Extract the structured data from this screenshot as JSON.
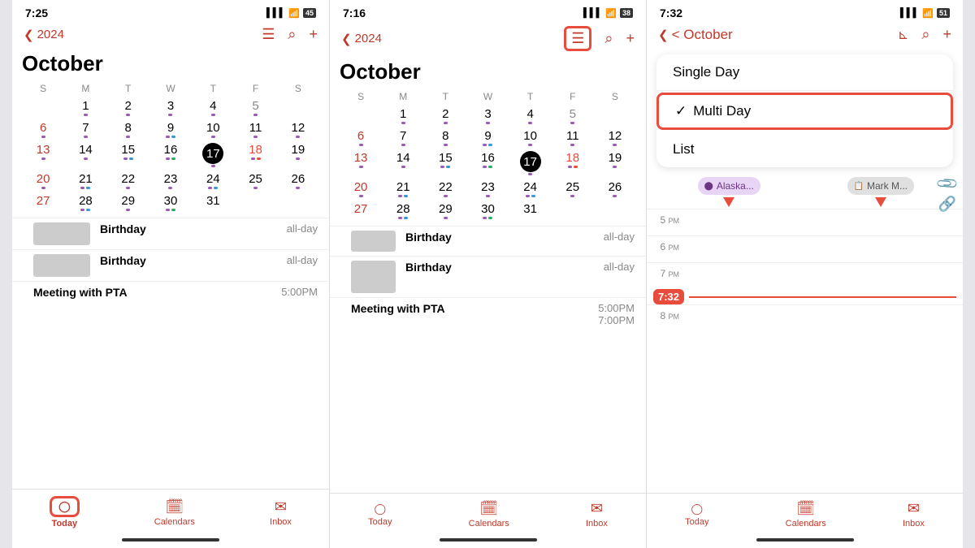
{
  "phone1": {
    "status_time": "7:25",
    "status_signal": "▌▌▌",
    "status_wifi": "WiFi",
    "status_battery": "45",
    "nav_back": "< 2024",
    "nav_year": "2024",
    "month_title": "October",
    "day_headers": [
      "S",
      "M",
      "T",
      "W",
      "T",
      "F",
      "S"
    ],
    "calendar_weeks": [
      [
        {
          "n": "",
          "dots": []
        },
        {
          "n": "1",
          "dots": [
            "purple"
          ]
        },
        {
          "n": "2",
          "dots": [
            "purple"
          ]
        },
        {
          "n": "3",
          "dots": [
            "purple"
          ]
        },
        {
          "n": "4",
          "dots": [
            "purple"
          ]
        },
        {
          "n": "5",
          "dots": [
            "purple"
          ],
          "cls": "saturday"
        },
        {
          "n": "",
          "dots": []
        }
      ],
      [
        {
          "n": "6",
          "cls": "sunday",
          "dots": [
            "purple"
          ]
        },
        {
          "n": "7",
          "dots": [
            "purple"
          ]
        },
        {
          "n": "8",
          "dots": [
            "purple"
          ]
        },
        {
          "n": "9",
          "dots": [
            "purple",
            "blue"
          ]
        },
        {
          "n": "10",
          "dots": [
            "purple"
          ]
        },
        {
          "n": "11",
          "dots": [
            "purple"
          ]
        },
        {
          "n": "12",
          "dots": [
            "purple"
          ]
        }
      ],
      [
        {
          "n": "13",
          "cls": "sunday",
          "dots": [
            "purple"
          ]
        },
        {
          "n": "14",
          "dots": [
            "purple"
          ]
        },
        {
          "n": "15",
          "dots": [
            "purple",
            "blue"
          ]
        },
        {
          "n": "16",
          "dots": [
            "purple",
            "green"
          ]
        },
        {
          "n": "17",
          "cls": "today",
          "dots": [
            "purple"
          ]
        },
        {
          "n": "18",
          "cls": "red-num",
          "dots": [
            "purple",
            "red"
          ]
        },
        {
          "n": "19",
          "dots": [
            "purple"
          ]
        }
      ],
      [
        {
          "n": "20",
          "cls": "sunday",
          "dots": [
            "purple"
          ]
        },
        {
          "n": "21",
          "dots": [
            "purple",
            "blue"
          ]
        },
        {
          "n": "22",
          "dots": [
            "purple"
          ]
        },
        {
          "n": "23",
          "dots": [
            "purple"
          ]
        },
        {
          "n": "24",
          "dots": [
            "purple",
            "blue"
          ]
        },
        {
          "n": "25",
          "dots": [
            "purple"
          ]
        },
        {
          "n": "26",
          "dots": [
            "purple"
          ]
        }
      ],
      [
        {
          "n": "27",
          "cls": "sunday",
          "dots": []
        },
        {
          "n": "28",
          "dots": [
            "purple",
            "blue"
          ]
        },
        {
          "n": "29",
          "dots": [
            "purple"
          ]
        },
        {
          "n": "30",
          "dots": [
            "purple",
            "green"
          ]
        },
        {
          "n": "31",
          "dots": []
        },
        {
          "n": "",
          "dots": []
        },
        {
          "n": "",
          "dots": []
        }
      ]
    ],
    "events": [
      {
        "bar": "purple",
        "thumb": true,
        "name": "Birthday",
        "sub": "blurred1",
        "time": "all-day"
      },
      {
        "bar": "red",
        "thumb": true,
        "name": "Birthday",
        "sub": "blurred2",
        "time": "all-day"
      },
      {
        "bar": "purple",
        "thumb": false,
        "name": "Meeting with PTA",
        "time": "5:00PM"
      }
    ],
    "tabs": [
      {
        "icon": "circle",
        "label": "Today",
        "active": true,
        "boxed": true
      },
      {
        "icon": "calendar",
        "label": "Calendars"
      },
      {
        "icon": "inbox",
        "label": "Inbox"
      }
    ]
  },
  "phone2": {
    "status_time": "7:16",
    "status_battery": "38",
    "nav_year": "2024",
    "month_title": "October",
    "nav_icon_highlighted": true,
    "events": [
      {
        "bar": "purple",
        "thumb": true,
        "name": "Birthday",
        "sub": "blurred1",
        "time": "all-day"
      },
      {
        "bar": "red",
        "thumb": true,
        "name": "Birthday",
        "sub": "blurred2",
        "time": "all-day"
      },
      {
        "bar": "purple",
        "thumb": false,
        "name": "Meeting with PTA",
        "time": "5:00PM",
        "time2": "7:00PM"
      }
    ],
    "tabs": [
      {
        "icon": "circle",
        "label": "Today"
      },
      {
        "icon": "calendar",
        "label": "Calendars"
      },
      {
        "icon": "inbox",
        "label": "Inbox"
      }
    ]
  },
  "phone3": {
    "status_time": "7:32",
    "status_battery": "51",
    "nav_back": "< October",
    "month_title": "October",
    "dropdown": {
      "items": [
        {
          "label": "Single Day",
          "check": false
        },
        {
          "label": "Multi Day",
          "check": true,
          "highlighted": true
        },
        {
          "label": "List",
          "check": false
        }
      ]
    },
    "event_labels": [
      {
        "text": "Alaska...",
        "type": "purple"
      },
      {
        "text": "Mark M...",
        "type": "gray"
      }
    ],
    "hours": [
      {
        "label": "5 PM",
        "content": ""
      },
      {
        "label": "6 PM",
        "content": ""
      },
      {
        "label": "7 PM",
        "content": ""
      },
      {
        "label": "8 PM",
        "content": ""
      }
    ],
    "time_now": "7:32",
    "tabs": [
      {
        "icon": "circle",
        "label": "Today"
      },
      {
        "icon": "calendar",
        "label": "Calendars"
      },
      {
        "icon": "inbox",
        "label": "Inbox"
      }
    ]
  }
}
